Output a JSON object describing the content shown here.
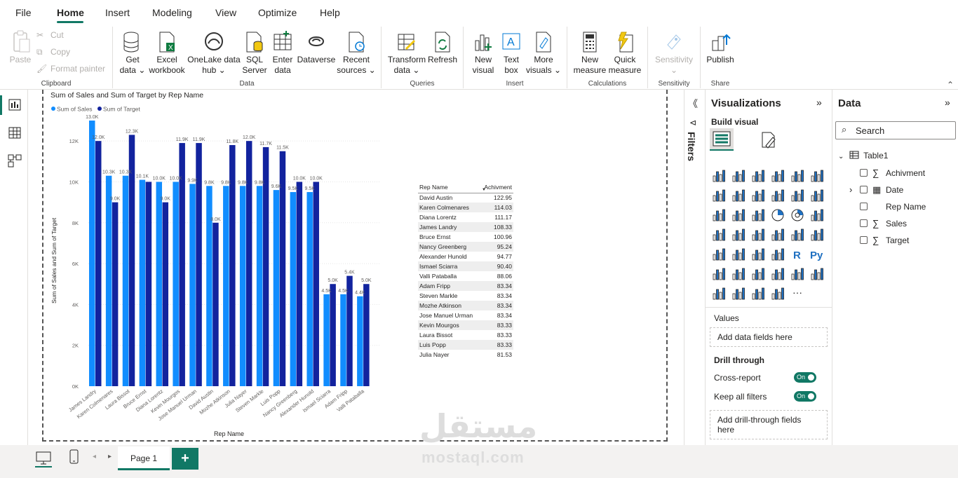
{
  "menu": {
    "file": "File",
    "home": "Home",
    "insert": "Insert",
    "modeling": "Modeling",
    "view": "View",
    "optimize": "Optimize",
    "help": "Help"
  },
  "ribbon": {
    "paste": "Paste",
    "cut": "Cut",
    "copy": "Copy",
    "format_painter": "Format painter",
    "clipboard": "Clipboard",
    "get_data": [
      "Get",
      "data ⌄"
    ],
    "excel": [
      "Excel",
      "workbook"
    ],
    "onelake": [
      "OneLake data",
      "hub ⌄"
    ],
    "sql": [
      "SQL",
      "Server"
    ],
    "enter_data": [
      "Enter",
      "data"
    ],
    "dataverse": [
      "Dataverse",
      ""
    ],
    "recent": [
      "Recent",
      "sources ⌄"
    ],
    "data_group": "Data",
    "transform": [
      "Transform",
      "data ⌄"
    ],
    "refresh": [
      "Refresh",
      ""
    ],
    "queries": "Queries",
    "new_visual": [
      "New",
      "visual"
    ],
    "text_box": [
      "Text",
      "box"
    ],
    "more_visuals": [
      "More",
      "visuals ⌄"
    ],
    "insert_group": "Insert",
    "new_measure": [
      "New",
      "measure"
    ],
    "quick_measure": [
      "Quick",
      "measure"
    ],
    "calculations": "Calculations",
    "sensitivity": [
      "Sensitivity",
      "⌄"
    ],
    "sensitivity_group": "Sensitivity",
    "publish": [
      "Publish",
      ""
    ],
    "share": "Share"
  },
  "chart_data": {
    "type": "bar",
    "title": "Sum of Sales and Sum of Target by Rep Name",
    "xlabel": "Rep Name",
    "ylabel": "Sum of Sales and Sum of Target",
    "ylim": [
      0,
      13000
    ],
    "yticks": [
      "0K",
      "2K",
      "4K",
      "6K",
      "8K",
      "10K",
      "12K"
    ],
    "categories": [
      "James Landry",
      "Karen Colmenares",
      "Laura Bissot",
      "Bruce Ernst",
      "Diana Lorentz",
      "Kevin Mourgos",
      "Jose Manuel Urman",
      "David Austin",
      "Mozhe Atkinson",
      "Julia Nayer",
      "Steven Markle",
      "Luis Popp",
      "Nancy Greenberg",
      "Alexander Hunold",
      "Ismael Sciarra",
      "Adam Fripp",
      "Valli Pataballa"
    ],
    "series": [
      {
        "name": "Sum of Sales",
        "color": "#118DFF",
        "values": [
          13000,
          10300,
          10300,
          10100,
          10000,
          10000,
          9900,
          9800,
          9800,
          9800,
          9800,
          9600,
          9500,
          9500,
          4500,
          4500,
          4400
        ],
        "labels": [
          "13.0K",
          "10.3K",
          "10.3K",
          "10.1K",
          "10.0K",
          "10.0K",
          "9.9K",
          "9.8K",
          "9.8K",
          "9.8K",
          "9.8K",
          "9.6K",
          "9.5K",
          "9.5K",
          "4.5K",
          "4.5K",
          "4.4K"
        ]
      },
      {
        "name": "Sum of Target",
        "color": "#12239E",
        "values": [
          12000,
          9000,
          12300,
          10000,
          9000,
          11900,
          11900,
          8000,
          11800,
          12000,
          11700,
          11500,
          10000,
          10000,
          5000,
          5400,
          5000
        ],
        "labels": [
          "12.0K",
          "9.0K",
          "12.3K",
          "",
          "9.0K",
          "11.9K",
          "11.9K",
          "8.0K",
          "11.8K",
          "12.0K",
          "11.7K",
          "11.5K",
          "10.0K",
          "10.0K",
          "5.0K",
          "5.4K",
          "5.0K"
        ]
      }
    ]
  },
  "table": {
    "headers": [
      "Rep Name",
      "Achivment"
    ],
    "rows": [
      [
        "David Austin",
        "122.95"
      ],
      [
        "Karen Colmenares",
        "114.03"
      ],
      [
        "Diana Lorentz",
        "111.17"
      ],
      [
        "James Landry",
        "108.33"
      ],
      [
        "Bruce Ernst",
        "100.96"
      ],
      [
        "Nancy Greenberg",
        "95.24"
      ],
      [
        "Alexander Hunold",
        "94.77"
      ],
      [
        "Ismael Sciarra",
        "90.40"
      ],
      [
        "Valli Pataballa",
        "88.06"
      ],
      [
        "Adam Fripp",
        "83.34"
      ],
      [
        "Steven Markle",
        "83.34"
      ],
      [
        "Mozhe Atkinson",
        "83.34"
      ],
      [
        "Jose Manuel Urman",
        "83.34"
      ],
      [
        "Kevin Mourgos",
        "83.33"
      ],
      [
        "Laura Bissot",
        "83.33"
      ],
      [
        "Luis Popp",
        "83.33"
      ],
      [
        "Julia Nayer",
        "81.53"
      ]
    ]
  },
  "filters": {
    "label": "Filters"
  },
  "visualizations": {
    "title": "Visualizations",
    "build_visual": "Build visual",
    "values": "Values",
    "add_data": "Add data fields here",
    "drill_through": "Drill through",
    "cross_report": "Cross-report",
    "keep_filters": "Keep all filters",
    "on": "On",
    "add_drill": "Add drill-through fields here"
  },
  "data_pane": {
    "title": "Data",
    "search_placeholder": "Search",
    "table": "Table1",
    "fields": [
      "Achivment",
      "Date",
      "Rep Name",
      "Sales",
      "Target"
    ]
  },
  "pages": {
    "page1": "Page 1",
    "add": "+"
  },
  "watermark": {
    "arabic": "مستقل",
    "latin": "mostaql.com"
  }
}
